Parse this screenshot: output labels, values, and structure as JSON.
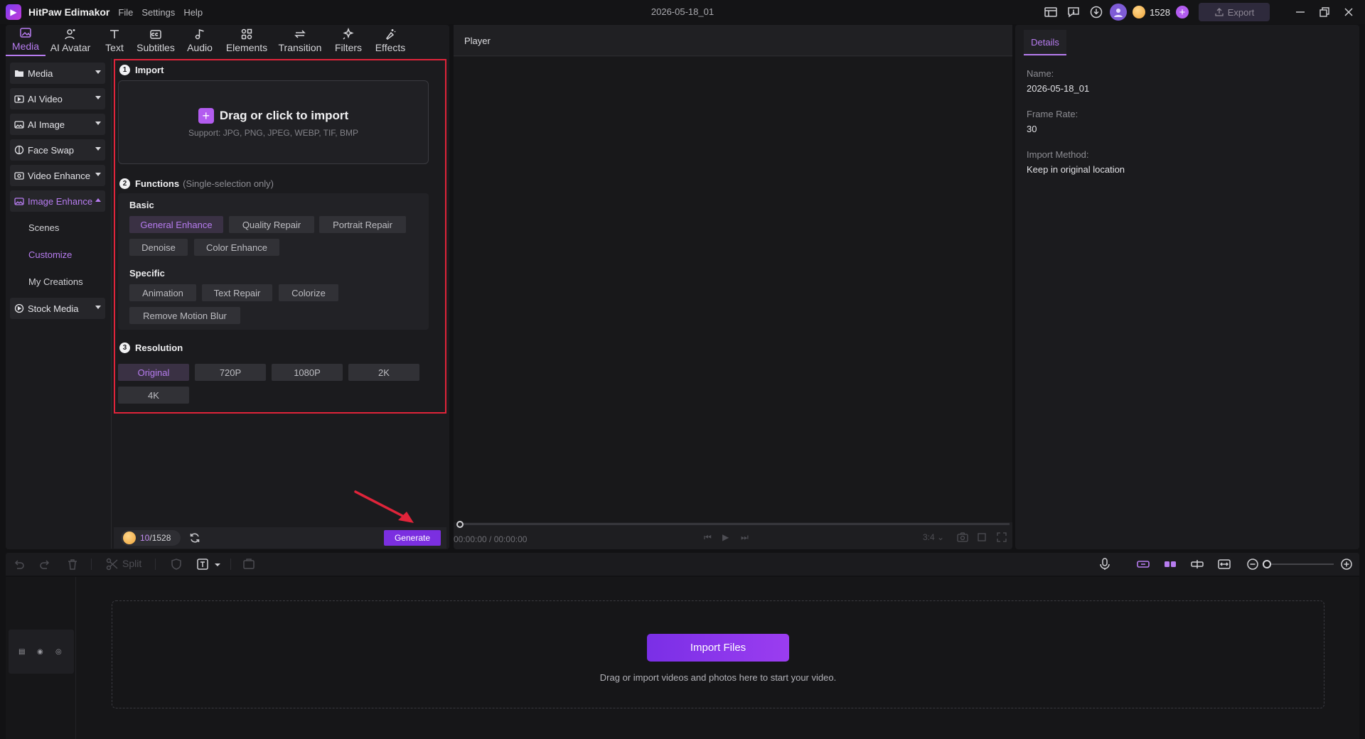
{
  "titlebar": {
    "app_name": "HitPaw Edimakor",
    "menu": [
      "File",
      "Settings",
      "Help"
    ],
    "project_title": "2026-05-18_01",
    "credits": "1528",
    "export_label": "Export"
  },
  "tool_tabs": [
    {
      "label": "Media",
      "icon": "media-icon"
    },
    {
      "label": "AI Avatar",
      "icon": "ai-avatar-icon"
    },
    {
      "label": "Text",
      "icon": "text-icon"
    },
    {
      "label": "Subtitles",
      "icon": "subtitles-icon"
    },
    {
      "label": "Audio",
      "icon": "audio-icon"
    },
    {
      "label": "Elements",
      "icon": "elements-icon"
    },
    {
      "label": "Transition",
      "icon": "transition-icon"
    },
    {
      "label": "Filters",
      "icon": "filters-icon"
    },
    {
      "label": "Effects",
      "icon": "effects-icon"
    }
  ],
  "side_nav": {
    "items": [
      {
        "label": "Media"
      },
      {
        "label": "AI Video"
      },
      {
        "label": "AI Image"
      },
      {
        "label": "Face Swap"
      },
      {
        "label": "Video Enhance"
      },
      {
        "label": "Image Enhance"
      }
    ],
    "sub_items": [
      "Scenes",
      "Customize",
      "My Creations"
    ],
    "stock_media": "Stock Media"
  },
  "enhance": {
    "step1_num": "1",
    "step1_title": "Import",
    "drop_main": "Drag or click to import",
    "drop_sub": "Support: JPG, PNG, JPEG, WEBP, TIF, BMP",
    "step2_num": "2",
    "step2_title": "Functions",
    "step2_hint": "(Single-selection only)",
    "basic_title": "Basic",
    "basic": [
      "General Enhance",
      "Quality Repair",
      "Portrait Repair",
      "Denoise",
      "Color Enhance"
    ],
    "specific_title": "Specific",
    "specific": [
      "Animation",
      "Text Repair",
      "Colorize",
      "Remove Motion Blur"
    ],
    "step3_num": "3",
    "step3_title": "Resolution",
    "resolutions": [
      "Original",
      "720P",
      "1080P",
      "2K",
      "4K"
    ],
    "selected_function": "General Enhance",
    "selected_resolution": "Original"
  },
  "generate_bar": {
    "used": "10",
    "total": "/1528",
    "generate_label": "Generate"
  },
  "player": {
    "title": "Player",
    "time": "00:00:00 / 00:00:00",
    "ratio": "3:4"
  },
  "details": {
    "tab": "Details",
    "name_label": "Name:",
    "name_value": "2026-05-18_01",
    "frame_rate_label": "Frame Rate:",
    "frame_rate_value": "30",
    "import_method_label": "Import Method:",
    "import_method_value": "Keep in original location"
  },
  "timeline": {
    "split_label": "Split",
    "import_files_label": "Import Files",
    "hint": "Drag or import videos and photos here to start your video."
  },
  "colors": {
    "accent": "#b77cf0",
    "primary_button": "#7b2fe0",
    "highlight_border": "#e0243a"
  }
}
